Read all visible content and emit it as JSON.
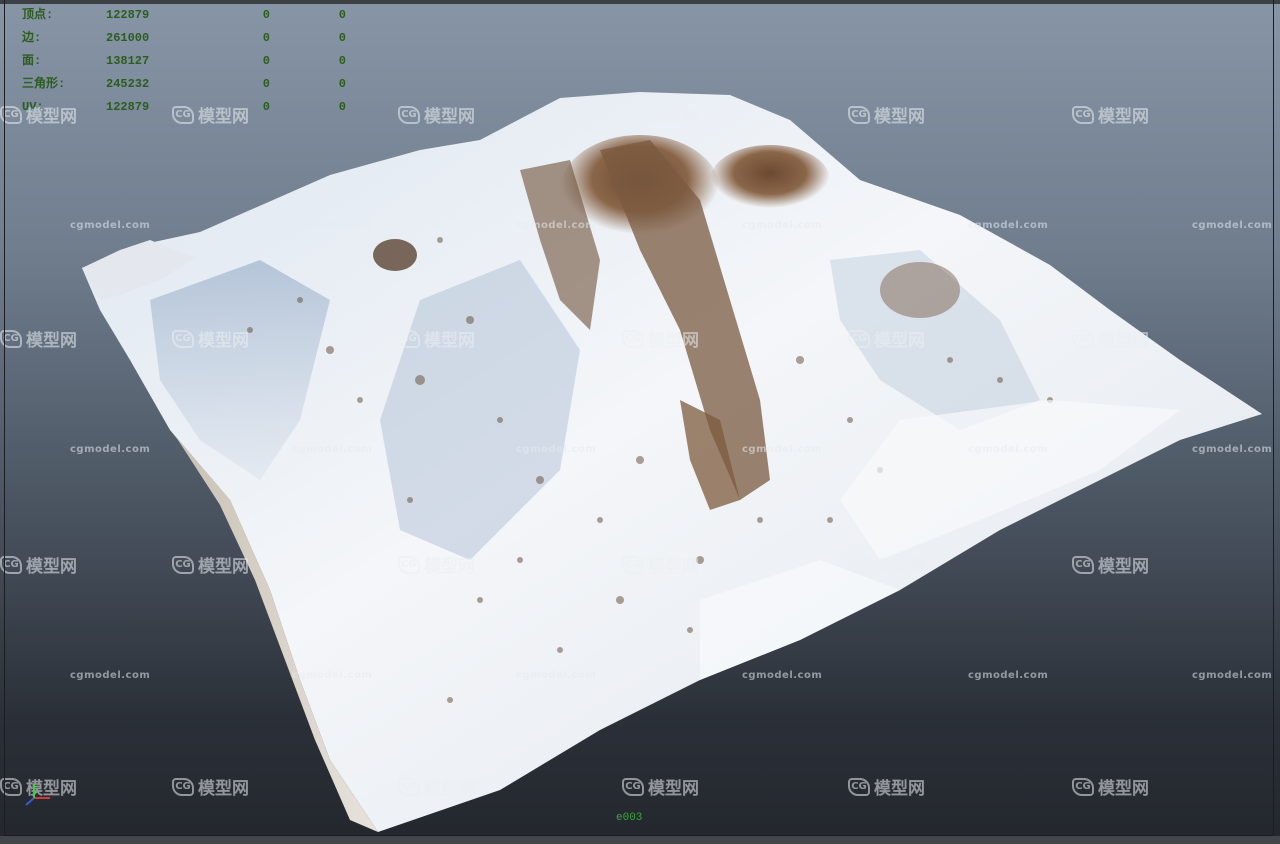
{
  "hud": {
    "rows": [
      {
        "label": "顶点:",
        "v1": "122879",
        "v2": "0",
        "v3": "0"
      },
      {
        "label": "边:",
        "v1": "261000",
        "v2": "0",
        "v3": "0"
      },
      {
        "label": "面:",
        "v1": "138127",
        "v2": "0",
        "v3": "0"
      },
      {
        "label": "三角形:",
        "v1": "245232",
        "v2": "0",
        "v3": "0"
      },
      {
        "label": "UV:",
        "v1": "122879",
        "v2": "0",
        "v3": "0"
      }
    ]
  },
  "watermark": {
    "site": "cgmodel.com",
    "brand": "模型网",
    "logo_glyph": "CG"
  },
  "frame_counter": "e003",
  "colors": {
    "hud_text": "#2b5d1f",
    "frame_counter": "#3aa83a",
    "axis_x": "#d23a3a",
    "axis_y": "#3ad23a",
    "axis_z": "#3a5ad2"
  }
}
